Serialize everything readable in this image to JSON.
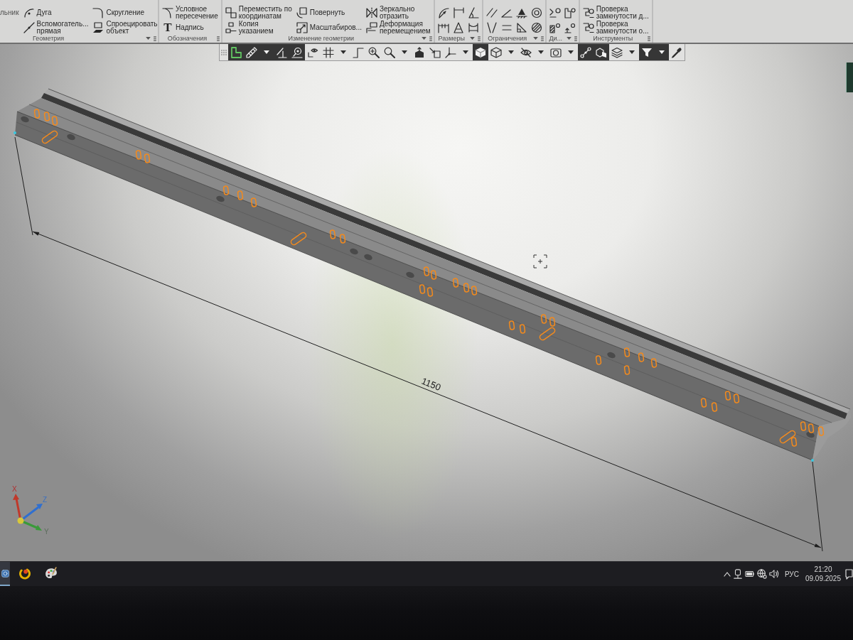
{
  "ribbon": {
    "panels": [
      {
        "title": "Геометрия",
        "kind": "commands",
        "menu": true,
        "columns": [
          [
            {
              "label": "льник"
            }
          ],
          [
            {
              "label": "Дуга"
            },
            {
              "label": "Вспомогатель...\nпрямая"
            }
          ],
          [
            {
              "label": "Скругление"
            },
            {
              "label": "Спроецировать\nобъект"
            }
          ]
        ]
      },
      {
        "title": "Обозначения",
        "kind": "commands",
        "menu": false,
        "columns": [
          [
            {
              "label": "Условное\nпересечение"
            },
            {
              "label": "Надпись",
              "glyph": "T"
            }
          ]
        ]
      },
      {
        "title": "Изменение геометрии",
        "kind": "commands",
        "menu": true,
        "columns": [
          [
            {
              "label": "Переместить по\nкоординатам"
            },
            {
              "label": "Копия\nуказанием"
            }
          ],
          [
            {
              "label": "Повернуть"
            },
            {
              "label": "Масштабиров..."
            }
          ],
          [
            {
              "label": "Зеркально\nотразить"
            },
            {
              "label": "Деформация\nперемещением"
            }
          ]
        ]
      },
      {
        "title": "Размеры",
        "kind": "icons",
        "menu": true
      },
      {
        "title": "Ограничения",
        "kind": "icons",
        "menu": true
      },
      {
        "title": "Ди...",
        "kind": "icons",
        "menu": true
      },
      {
        "title": "Инструменты",
        "kind": "commands",
        "menu": false,
        "columns": [
          [
            {
              "label": "Проверка\nзамкнутости д..."
            },
            {
              "label": "Проверка\nзамкнутости о..."
            }
          ]
        ]
      }
    ]
  },
  "view_toolbar": {
    "items": [
      {
        "kind": "button",
        "selected": true
      },
      {
        "kind": "button",
        "selected": true
      },
      {
        "kind": "arrow",
        "selected": true
      },
      {
        "kind": "button",
        "selected": true
      },
      {
        "kind": "button",
        "selected": true
      },
      {
        "kind": "button",
        "selected": false
      },
      {
        "kind": "button",
        "selected": false
      },
      {
        "kind": "arrow",
        "selected": false
      },
      {
        "kind": "button",
        "selected": false
      },
      {
        "kind": "button",
        "selected": false
      },
      {
        "kind": "button",
        "selected": false
      },
      {
        "kind": "arrow",
        "selected": false
      },
      {
        "kind": "button",
        "selected": false
      },
      {
        "kind": "button",
        "selected": false
      },
      {
        "kind": "button",
        "selected": false
      },
      {
        "kind": "arrow",
        "selected": false
      },
      {
        "kind": "button",
        "selected": true
      },
      {
        "kind": "button",
        "selected": false
      },
      {
        "kind": "arrow",
        "selected": false
      },
      {
        "kind": "button",
        "selected": false
      },
      {
        "kind": "arrow",
        "selected": false
      },
      {
        "kind": "button",
        "selected": false
      },
      {
        "kind": "arrow",
        "selected": false
      },
      {
        "kind": "button",
        "selected": true
      },
      {
        "kind": "button",
        "selected": true
      },
      {
        "kind": "button",
        "selected": false
      },
      {
        "kind": "arrow",
        "selected": false
      },
      {
        "kind": "button",
        "selected": true
      },
      {
        "kind": "arrow",
        "selected": true
      },
      {
        "kind": "button",
        "selected": false
      }
    ]
  },
  "viewport": {
    "dimension": {
      "value": "1150"
    },
    "axis_triad": {
      "x": "X",
      "y": "Y",
      "z": "Z"
    }
  },
  "taskbar": {
    "apps": [
      {
        "selected": true
      },
      {
        "selected": false
      },
      {
        "selected": false
      }
    ],
    "tray": {
      "language": "РУС",
      "time": "21:20",
      "date": "09.09.2025"
    }
  }
}
